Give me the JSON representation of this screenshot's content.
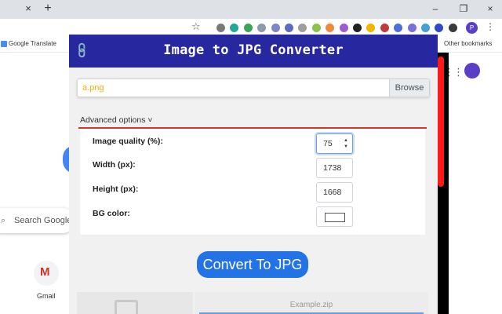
{
  "browser": {
    "tab_close": "×",
    "new_tab": "+",
    "window_controls": {
      "minimize": "–",
      "restore": "❐",
      "close": "×"
    },
    "star": "☆",
    "menu": "⋮",
    "profile_initial": "P",
    "bookmarks": [
      {
        "label": "Google Translate"
      }
    ],
    "other_bookmarks": "Other bookmarks",
    "extension_colors": [
      "#7a7a7a",
      "#26a69a",
      "#3aa556",
      "#8e9aa8",
      "#7b86c9",
      "#5c6bc0",
      "#9e9e9e",
      "#8bc34a",
      "#ef8a3a",
      "#9c5bd1",
      "#222222",
      "#f4b400",
      "#c23b3b",
      "#4e6fd9",
      "#7a6fdd",
      "#44a0d4",
      "#2f49c9",
      "#3a3a3a"
    ]
  },
  "google": {
    "search_placeholder": "Search Google",
    "search_icon": "⌕",
    "shortcut_label": "Gmail",
    "gmail_glyph": "M",
    "apps_glyph": "⋮⋮⋮"
  },
  "popup": {
    "title": "Image to JPG Converter",
    "link_icon": "🔗",
    "file_value": "a.png",
    "browse_label": "Browse",
    "advanced_label": "Advanced options ˅",
    "options": {
      "quality_label": "Image quality (%):",
      "quality_value": "75",
      "width_label": "Width (px):",
      "width_value": "1738",
      "height_label": "Height (px):",
      "height_value": "1668",
      "bg_label": "BG color:",
      "bg_value": "#ffffff"
    },
    "convert_label": "Convert To JPG",
    "example_label": "Example.zip"
  },
  "colors": {
    "header": "#2727a0",
    "accent_rule": "#d9332e",
    "convert_button": "#2473e6",
    "scroll_thumb": "#ff1a1a"
  }
}
